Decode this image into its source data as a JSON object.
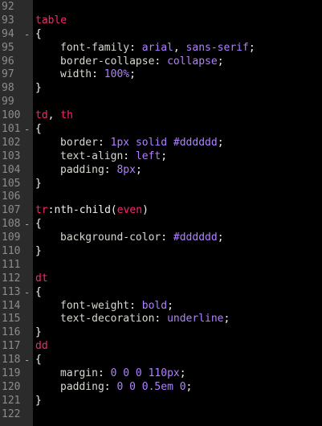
{
  "editor": {
    "lines": [
      {
        "num": "92",
        "fold": "",
        "tokens": []
      },
      {
        "num": "93",
        "fold": "",
        "tokens": [
          {
            "t": "sel",
            "v": "table"
          }
        ]
      },
      {
        "num": "94",
        "fold": "-",
        "tokens": [
          {
            "t": "punc",
            "v": "{"
          }
        ]
      },
      {
        "num": "95",
        "fold": "",
        "indent": true,
        "tokens": [
          {
            "t": "prop",
            "v": "font-family"
          },
          {
            "t": "punc",
            "v": ": "
          },
          {
            "t": "val",
            "v": "arial"
          },
          {
            "t": "punc",
            "v": ", "
          },
          {
            "t": "val",
            "v": "sans-serif"
          },
          {
            "t": "punc",
            "v": ";"
          }
        ]
      },
      {
        "num": "96",
        "fold": "",
        "indent": true,
        "tokens": [
          {
            "t": "prop",
            "v": "border-collapse"
          },
          {
            "t": "punc",
            "v": ": "
          },
          {
            "t": "val",
            "v": "collapse"
          },
          {
            "t": "punc",
            "v": ";"
          }
        ]
      },
      {
        "num": "97",
        "fold": "",
        "indent": true,
        "tokens": [
          {
            "t": "prop",
            "v": "width"
          },
          {
            "t": "punc",
            "v": ": "
          },
          {
            "t": "val",
            "v": "100%"
          },
          {
            "t": "punc",
            "v": ";"
          }
        ]
      },
      {
        "num": "98",
        "fold": "",
        "tokens": [
          {
            "t": "punc",
            "v": "}"
          }
        ]
      },
      {
        "num": "99",
        "fold": "",
        "tokens": []
      },
      {
        "num": "100",
        "fold": "",
        "tokens": [
          {
            "t": "sel",
            "v": "td"
          },
          {
            "t": "punc",
            "v": ", "
          },
          {
            "t": "sel",
            "v": "th"
          }
        ]
      },
      {
        "num": "101",
        "fold": "-",
        "tokens": [
          {
            "t": "punc",
            "v": "{"
          }
        ]
      },
      {
        "num": "102",
        "fold": "",
        "indent": true,
        "tokens": [
          {
            "t": "prop",
            "v": "border"
          },
          {
            "t": "punc",
            "v": ": "
          },
          {
            "t": "val",
            "v": "1px"
          },
          {
            "t": "punc",
            "v": " "
          },
          {
            "t": "val",
            "v": "solid"
          },
          {
            "t": "punc",
            "v": " "
          },
          {
            "t": "val",
            "v": "#dddddd"
          },
          {
            "t": "punc",
            "v": ";"
          }
        ]
      },
      {
        "num": "103",
        "fold": "",
        "indent": true,
        "tokens": [
          {
            "t": "prop",
            "v": "text-align"
          },
          {
            "t": "punc",
            "v": ": "
          },
          {
            "t": "val",
            "v": "left"
          },
          {
            "t": "punc",
            "v": ";"
          }
        ]
      },
      {
        "num": "104",
        "fold": "",
        "indent": true,
        "tokens": [
          {
            "t": "prop",
            "v": "padding"
          },
          {
            "t": "punc",
            "v": ": "
          },
          {
            "t": "val",
            "v": "8px"
          },
          {
            "t": "punc",
            "v": ";"
          }
        ]
      },
      {
        "num": "105",
        "fold": "",
        "tokens": [
          {
            "t": "punc",
            "v": "}"
          }
        ]
      },
      {
        "num": "106",
        "fold": "",
        "tokens": []
      },
      {
        "num": "107",
        "fold": "",
        "tokens": [
          {
            "t": "sel",
            "v": "tr"
          },
          {
            "t": "punc",
            "v": ":nth-child("
          },
          {
            "t": "sel",
            "v": "even"
          },
          {
            "t": "punc",
            "v": ")"
          }
        ]
      },
      {
        "num": "108",
        "fold": "-",
        "tokens": [
          {
            "t": "punc",
            "v": "{"
          }
        ]
      },
      {
        "num": "109",
        "fold": "",
        "indent": true,
        "tokens": [
          {
            "t": "prop",
            "v": "background-color"
          },
          {
            "t": "punc",
            "v": ": "
          },
          {
            "t": "val",
            "v": "#dddddd"
          },
          {
            "t": "punc",
            "v": ";"
          }
        ]
      },
      {
        "num": "110",
        "fold": "",
        "tokens": [
          {
            "t": "punc",
            "v": "}"
          }
        ]
      },
      {
        "num": "111",
        "fold": "",
        "tokens": []
      },
      {
        "num": "112",
        "fold": "",
        "tokens": [
          {
            "t": "sel",
            "v": "dt"
          }
        ]
      },
      {
        "num": "113",
        "fold": "-",
        "tokens": [
          {
            "t": "punc",
            "v": "{"
          }
        ]
      },
      {
        "num": "114",
        "fold": "",
        "indent": true,
        "tokens": [
          {
            "t": "prop",
            "v": "font-weight"
          },
          {
            "t": "punc",
            "v": ": "
          },
          {
            "t": "val",
            "v": "bold"
          },
          {
            "t": "punc",
            "v": ";"
          }
        ]
      },
      {
        "num": "115",
        "fold": "",
        "indent": true,
        "tokens": [
          {
            "t": "prop",
            "v": "text-decoration"
          },
          {
            "t": "punc",
            "v": ": "
          },
          {
            "t": "val",
            "v": "underline"
          },
          {
            "t": "punc",
            "v": ";"
          }
        ]
      },
      {
        "num": "116",
        "fold": "",
        "tokens": [
          {
            "t": "punc",
            "v": "}"
          }
        ]
      },
      {
        "num": "117",
        "fold": "",
        "tokens": [
          {
            "t": "sel",
            "v": "dd"
          }
        ]
      },
      {
        "num": "118",
        "fold": "-",
        "tokens": [
          {
            "t": "punc",
            "v": "{"
          }
        ]
      },
      {
        "num": "119",
        "fold": "",
        "indent": true,
        "tokens": [
          {
            "t": "prop",
            "v": "margin"
          },
          {
            "t": "punc",
            "v": ": "
          },
          {
            "t": "val",
            "v": "0 0 0 110px"
          },
          {
            "t": "punc",
            "v": ";"
          }
        ]
      },
      {
        "num": "120",
        "fold": "",
        "indent": true,
        "tokens": [
          {
            "t": "prop",
            "v": "padding"
          },
          {
            "t": "punc",
            "v": ": "
          },
          {
            "t": "val",
            "v": "0 0 0.5em 0"
          },
          {
            "t": "punc",
            "v": ";"
          }
        ]
      },
      {
        "num": "121",
        "fold": "",
        "tokens": [
          {
            "t": "punc",
            "v": "}"
          }
        ]
      },
      {
        "num": "122",
        "fold": "",
        "tokens": []
      }
    ]
  },
  "colors": {
    "background": "#000000",
    "gutter_background": "#2b2b2b",
    "line_number": "#8c8c8c",
    "selector": "#f92672",
    "property": "#d8d8d0",
    "value": "#ae81ff",
    "punctuation": "#f2f2ec"
  },
  "icons": {
    "fold_marker": "fold-collapse-icon"
  }
}
